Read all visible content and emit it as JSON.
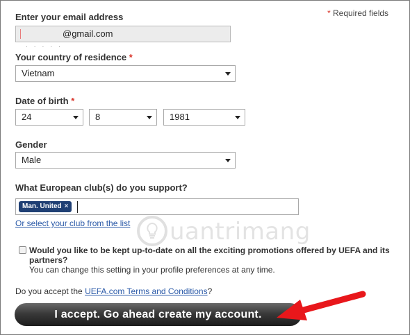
{
  "required_note": {
    "star": "*",
    "text": "Required fields"
  },
  "email": {
    "label": "Enter your email address",
    "value": "@gmail.com"
  },
  "country": {
    "label": "Your country of residence",
    "star": "*",
    "value": "Vietnam"
  },
  "dob": {
    "label": "Date of birth",
    "star": "*",
    "day": "24",
    "month": "8",
    "year": "1981"
  },
  "gender": {
    "label": "Gender",
    "value": "Male"
  },
  "club": {
    "label": "What European club(s) do you support?",
    "selected_tag": "Man. United",
    "remove_glyph": "×",
    "select_link": "Or select your club from the list"
  },
  "promotions": {
    "question": "Would you like to be kept up-to-date on all the exciting promotions offered by UEFA and its partners?",
    "note": "You can change this setting in your profile preferences at any time.",
    "checked": false
  },
  "terms": {
    "prefix": "Do you accept the ",
    "link": "UEFA.com Terms and Conditions",
    "suffix": "?"
  },
  "accept_button": "I accept. Go ahead create my account.",
  "watermark": {
    "text": "uantrimang",
    "icon": "lightbulb-logo"
  },
  "annotation": {
    "color": "#e8171b",
    "icon": "red-arrow-icon"
  }
}
